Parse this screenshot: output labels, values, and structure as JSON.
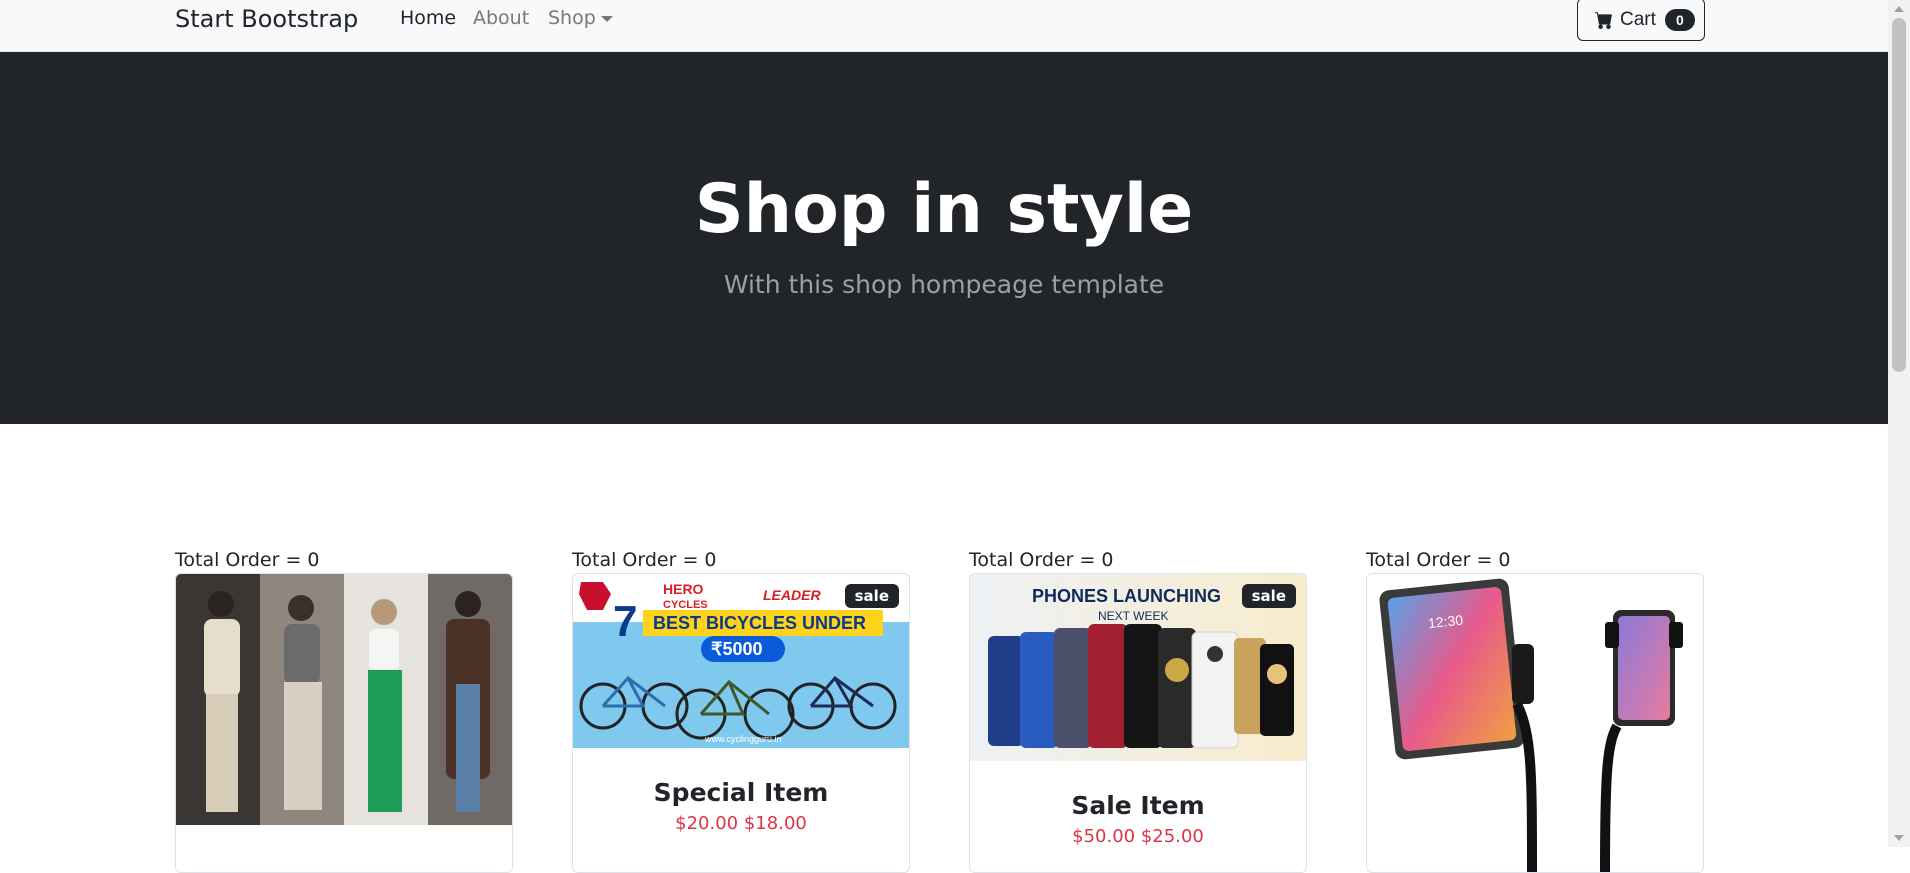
{
  "navbar": {
    "brand": "Start Bootstrap",
    "links": [
      {
        "label": "Home"
      },
      {
        "label": "About"
      },
      {
        "label": "Shop"
      }
    ],
    "cart": {
      "label": "Cart",
      "count": "0"
    }
  },
  "hero": {
    "title": "Shop in style",
    "subtitle": "With this shop hompeage template"
  },
  "products": [
    {
      "total_order": "Total Order = 0",
      "image": "clothing-photo"
    },
    {
      "total_order": "Total Order = 0",
      "badge": "sale",
      "title": "Special Item",
      "price_old": "$20.00",
      "price_new": "$18.00",
      "image": {
        "text_hero": "HERO",
        "text_cycles": "CYCLES",
        "text_leader": "LEADER",
        "text_number": "7",
        "text_headline": "BEST BICYCLES UNDER",
        "text_price": "₹5000",
        "text_url": "www.cyclingguru.in"
      }
    },
    {
      "total_order": "Total Order = 0",
      "badge": "sale",
      "title": "Sale Item",
      "price_old": "$50.00",
      "price_new": "$25.00",
      "image": {
        "text_headline": "PHONES LAUNCHING",
        "text_sub": "NEXT WEEK"
      }
    },
    {
      "total_order": "Total Order = 0",
      "image": {
        "text_time": "12:30"
      }
    }
  ],
  "colors": {
    "navbar_bg": "#f8f9fa",
    "hero_bg": "#212529",
    "price": "#dc3545"
  }
}
